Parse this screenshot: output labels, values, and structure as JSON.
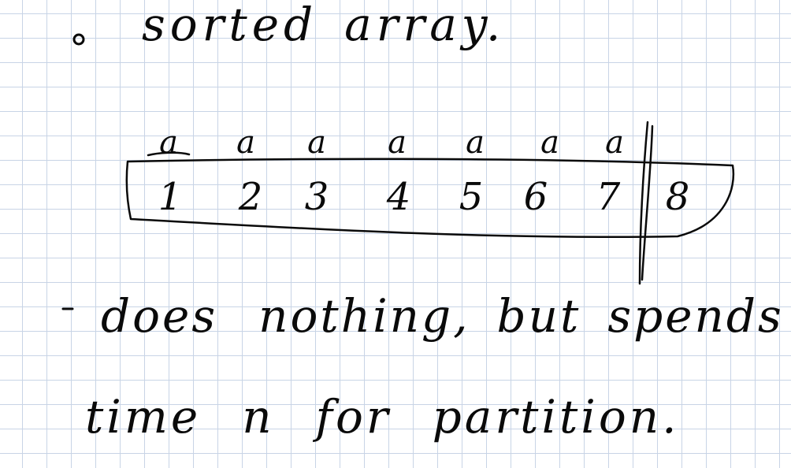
{
  "notes": {
    "line1": {
      "bullet": "•",
      "words": [
        "sorted",
        "array."
      ]
    },
    "line2": {
      "bullet": "-",
      "words": [
        "does",
        "nothing,",
        "but",
        "spends"
      ]
    },
    "line3": {
      "words": [
        "time",
        "n",
        "for",
        "partition."
      ]
    }
  },
  "array": {
    "cells": [
      "1",
      "2",
      "3",
      "4",
      "5",
      "6",
      "7",
      "8"
    ],
    "marks": [
      "a",
      "a",
      "a",
      "a",
      "a",
      "a",
      "a"
    ]
  }
}
